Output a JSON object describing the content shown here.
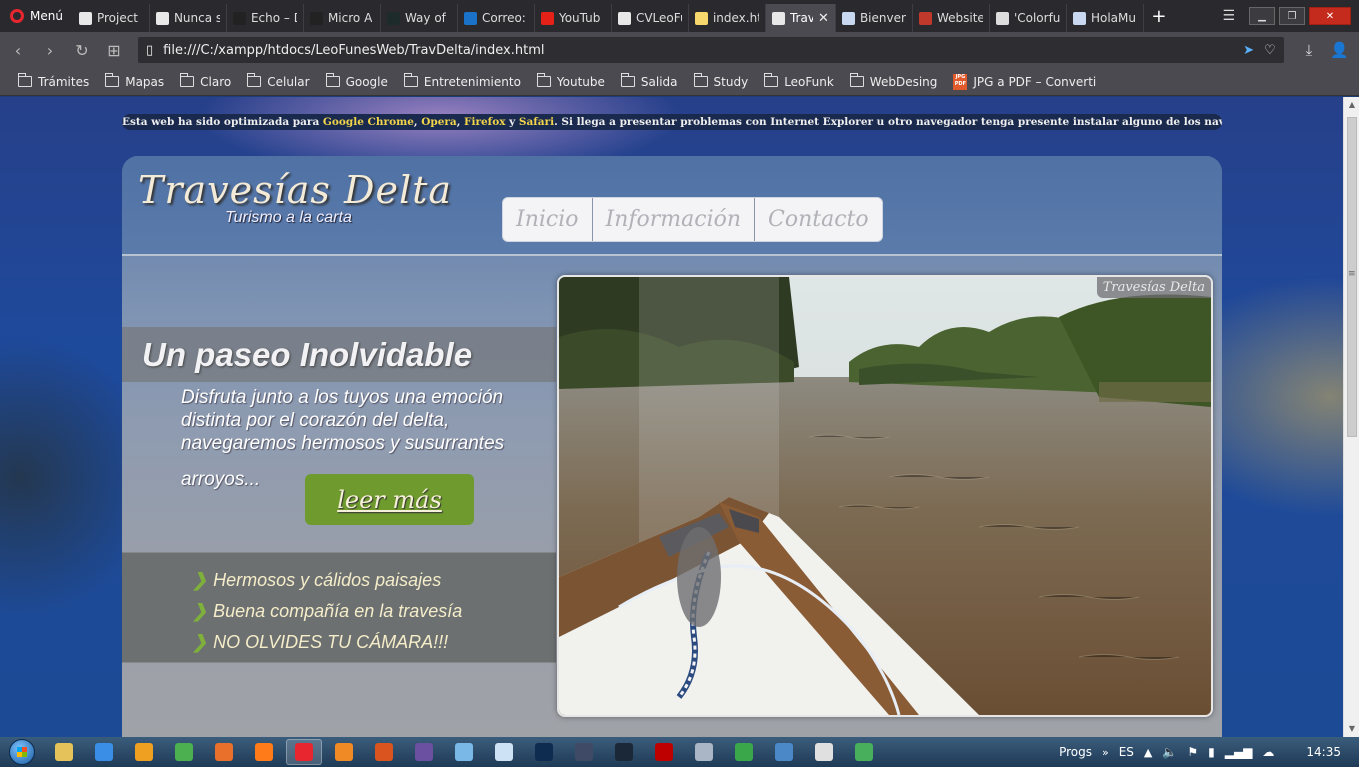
{
  "browser": {
    "menu_label": "Menú",
    "tabs": [
      {
        "label": "Project N",
        "icon": "document-icon",
        "color": "#e8e8e8"
      },
      {
        "label": "Nunca s",
        "icon": "document-icon",
        "color": "#e8e8e8"
      },
      {
        "label": "Echo – D",
        "icon": "fgp-icon",
        "color": "#222222"
      },
      {
        "label": "Micro A",
        "icon": "fgp-icon",
        "color": "#222222"
      },
      {
        "label": "Way of",
        "icon": "way-icon",
        "color": "#1d2b2b"
      },
      {
        "label": "Correo:",
        "icon": "outlook-icon",
        "color": "#1a73c8"
      },
      {
        "label": "YouTub",
        "icon": "youtube-icon",
        "color": "#e62117"
      },
      {
        "label": "CVLeoFu",
        "icon": "document-icon",
        "color": "#e8e8e8"
      },
      {
        "label": "index.ht",
        "icon": "bulb-icon",
        "color": "#f5d76e"
      },
      {
        "label": "Trav",
        "icon": "document-icon",
        "color": "#e8e8e8",
        "active": true
      },
      {
        "label": "Bienven",
        "icon": "book-icon",
        "color": "#c8d8f0"
      },
      {
        "label": "Website",
        "icon": "swirl-icon",
        "color": "#c0392b"
      },
      {
        "label": "'Colorfu",
        "icon": "palette-icon",
        "color": "#dddddd"
      },
      {
        "label": "HolaMu",
        "icon": "book-icon",
        "color": "#c8d8f0"
      }
    ],
    "url": "file:///C:/xampp/htdocs/LeoFunesWeb/TravDelta/index.html",
    "bookmarks": [
      {
        "label": "Trámites"
      },
      {
        "label": "Mapas"
      },
      {
        "label": "Claro"
      },
      {
        "label": "Celular"
      },
      {
        "label": "Google"
      },
      {
        "label": "Entretenimiento"
      },
      {
        "label": "Youtube"
      },
      {
        "label": "Salida"
      },
      {
        "label": "Study"
      },
      {
        "label": "LeoFunk"
      },
      {
        "label": "WebDesing"
      }
    ],
    "bookmark_pdf": "JPG a PDF – Converti",
    "pdf_badge": "JPG PDF"
  },
  "site": {
    "notice": {
      "before": "Esta web ha sido optimizada para ",
      "b1": "Google Chrome",
      "s1": ", ",
      "b2": "Opera",
      "s2": ", ",
      "b3": "Firefox",
      "s3": " y ",
      "b4": "Safari",
      "after": ". Si llega a presentar problemas con Internet Explorer u otro navegador tenga presente instalar alguno de los navegadores mencionados."
    },
    "logo_title": "Travesías Delta",
    "logo_subtitle": "Turismo a la carta",
    "nav": [
      "Inicio",
      "Información",
      "Contacto"
    ],
    "hero_title": "Un paseo Inolvidable",
    "hero_text": "Disfruta junto a los tuyos una emoción distinta por el corazón del delta, navegaremos hermosos y susurrantes",
    "hero_text_end": "arroyos...",
    "cta": "leer más",
    "features": [
      "Hermosos y cálidos paisajes",
      "Buena compañía en la travesía",
      "NO OLVIDES TU CÁMARA!!!"
    ],
    "photo_watermark": "Travesías Delta"
  },
  "taskbar": {
    "apps": [
      {
        "icon": "explorer-icon",
        "color": "#e6c35a"
      },
      {
        "icon": "ie-icon",
        "color": "#3a8ee6"
      },
      {
        "icon": "media-player-icon",
        "color": "#f0a020"
      },
      {
        "icon": "chrome-icon",
        "color": "#4caf50"
      },
      {
        "icon": "firefox-dev-icon",
        "color": "#e8702a"
      },
      {
        "icon": "firefox-icon",
        "color": "#ff7a18"
      },
      {
        "icon": "opera-icon",
        "color": "#e8262f",
        "active": true
      },
      {
        "icon": "brave-icon",
        "color": "#f08a24"
      },
      {
        "icon": "firefox-alt-icon",
        "color": "#d9541e"
      },
      {
        "icon": "fgp-app-icon",
        "color": "#6b4fa0"
      },
      {
        "icon": "paint-icon",
        "color": "#7ab8e8"
      },
      {
        "icon": "notepad-icon",
        "color": "#cde3f5"
      },
      {
        "icon": "photoshop-icon",
        "color": "#0d2c4f"
      },
      {
        "icon": "app-disc-icon",
        "color": "#3f4a66"
      },
      {
        "icon": "steam-icon",
        "color": "#1b2838"
      },
      {
        "icon": "filezilla-icon",
        "color": "#bf0000"
      },
      {
        "icon": "server-icon",
        "color": "#aab5c5"
      },
      {
        "icon": "green-app-icon",
        "color": "#3aa84a"
      },
      {
        "icon": "mail-app-icon",
        "color": "#4a88c8"
      },
      {
        "icon": "tool-icon",
        "color": "#e0e0e0"
      },
      {
        "icon": "globe-icon",
        "color": "#48b05c"
      }
    ],
    "progs_label": "Progs",
    "lang": "ES",
    "clock": "14:35"
  }
}
